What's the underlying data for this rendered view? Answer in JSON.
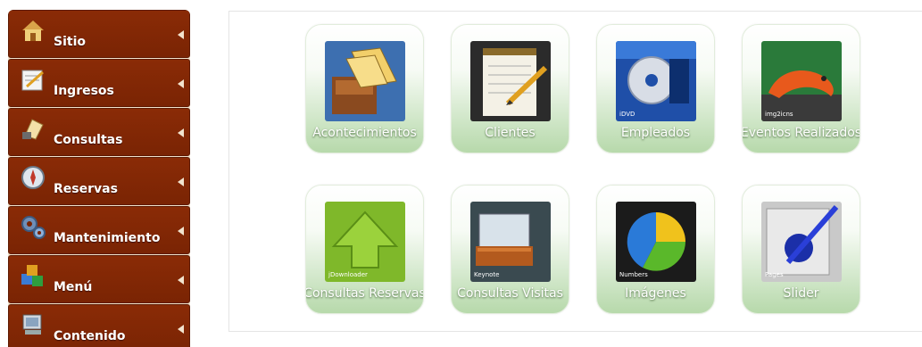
{
  "sidebar": {
    "items": [
      {
        "label": "Sitio",
        "icon": "house-icon"
      },
      {
        "label": "Ingresos",
        "icon": "notepad-icon"
      },
      {
        "label": "Consultas",
        "icon": "scroll-icon"
      },
      {
        "label": "Reservas",
        "icon": "compass-icon"
      },
      {
        "label": "Mantenimiento",
        "icon": "gears-icon"
      },
      {
        "label": "Menú",
        "icon": "blocks-icon"
      },
      {
        "label": "Contenido",
        "icon": "computer-icon"
      }
    ]
  },
  "tiles": [
    {
      "label": "Acontecimientos",
      "icon": "file-cabinet-icon"
    },
    {
      "label": "Clientes",
      "icon": "notepad-pencil-icon"
    },
    {
      "label": "Empleados",
      "icon": "dvd-icon",
      "tag": "iDVD"
    },
    {
      "label": "Eventos Realizados",
      "icon": "salamander-icon",
      "tag": "img2icns"
    },
    {
      "label": "Consultas Reservas",
      "icon": "download-arrow-icon",
      "tag": "jDownloader"
    },
    {
      "label": "Consultas Visitas",
      "icon": "keynote-icon",
      "tag": "Keynote"
    },
    {
      "label": "Imágenes",
      "icon": "pie-chart-icon",
      "tag": "Numbers"
    },
    {
      "label": "Slider",
      "icon": "pen-icon",
      "tag": "Pages"
    }
  ],
  "colors": {
    "sidebar_bg": "#7a2404",
    "tile_green": "#b7d9ab"
  }
}
